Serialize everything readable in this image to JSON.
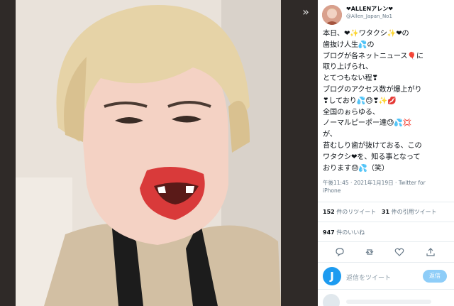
{
  "viewer": {
    "expand_icon": "double-chevron-right-icon"
  },
  "author": {
    "name": "❤ALLENアレン❤",
    "handle": "@Allen_Japan_No1"
  },
  "tweet": {
    "text": "本日、❤✨ワタクシ✨❤の\n歯抜け人生💦の\nブログが各ネットニュース🎈に\n取り上げられ、\nとてつもない程❣\nブログのアクセス数が爆上がり\n❣しており💦😓❣✨💋\n全国のぉらゆる、\nノーマルピーポー達😓💦💢\nが、\n苔むしり歯が抜けておる、この\nワタクシ❤を、知る事となって\nおります😓💦（笑）"
  },
  "meta": {
    "time": "午後11:45 · 2021年1月19日 · Twitter for iPhone"
  },
  "stats": {
    "retweets_count": "152",
    "retweets_label": " 件のリツイート",
    "quotes_count": "31",
    "quotes_label": " 件の引用ツイート",
    "likes_count": "947",
    "likes_label": " 件のいいね"
  },
  "actions": [
    "reply-icon",
    "retweet-icon",
    "like-icon",
    "share-icon"
  ],
  "reply": {
    "avatar_letter": "J",
    "placeholder": "返信をツイート",
    "button": "返信"
  },
  "colors": {
    "accent": "#1d9bf0",
    "muted": "#657786"
  }
}
